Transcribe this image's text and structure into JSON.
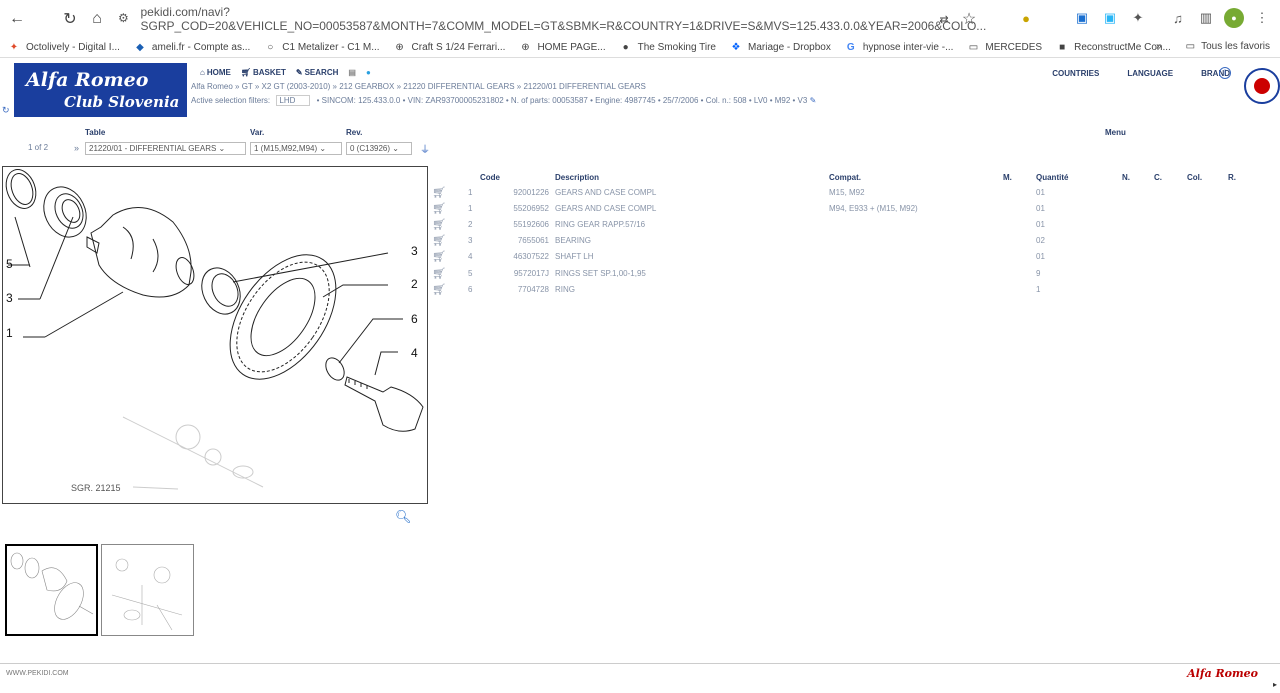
{
  "browser": {
    "url": "pekidi.com/navi?SGRP_COD=20&VEHICLE_NO=00053587&MONTH=7&COMM_MODEL=GT&SBMK=R&COUNTRY=1&DRIVE=S&MVS=125.433.0.0&YEAR=2006&COLO...",
    "bookmarks": [
      {
        "label": "Octolively - Digital I...",
        "icon": "octopus-icon",
        "color": "#e04a2a"
      },
      {
        "label": "ameli.fr - Compte as...",
        "icon": "ameli-icon",
        "color": "#1a5fb4"
      },
      {
        "label": "C1 Metalizer - C1 M...",
        "icon": "globe-icon",
        "color": "#555"
      },
      {
        "label": "Craft S 1/24 Ferrari...",
        "icon": "globe-icon",
        "color": "#555"
      },
      {
        "label": "HOME PAGE...",
        "icon": "globe-icon",
        "color": "#555"
      },
      {
        "label": "The Smoking Tire",
        "icon": "tire-icon",
        "color": "#222"
      },
      {
        "label": "Mariage - Dropbox",
        "icon": "dropbox-icon",
        "color": "#0061fe"
      },
      {
        "label": "hypnose inter-vie -...",
        "icon": "google-icon",
        "color": "#4285f4"
      },
      {
        "label": "MERCEDES",
        "icon": "folder-icon",
        "color": "#555"
      },
      {
        "label": "ReconstructMe Con...",
        "icon": "site-icon",
        "color": "#333"
      }
    ],
    "favorites_label": "Tous les favoris"
  },
  "header": {
    "logo_line1": "Alfa Romeo",
    "logo_line2": "Club Slovenia",
    "nav": [
      {
        "label": "HOME",
        "icon": "home-icon"
      },
      {
        "label": "BASKET",
        "icon": "basket-icon"
      },
      {
        "label": "SEARCH",
        "icon": "search-icon"
      }
    ],
    "right_nav": [
      "COUNTRIES",
      "LANGUAGE",
      "BRAND"
    ],
    "breadcrumb": "Alfa Romeo » GT » X2 GT (2003-2010) » 212 GEARBOX » 21220 DIFFERENTIAL GEARS » 21220/01 DIFFERENTIAL GEARS",
    "filters_label": "Active selection filters:",
    "filters_value": "LHD",
    "filters_rest": "• SINCOM: 125.433.0.0 • VIN: ZAR93700005231802 • N. of parts: 00053587 • Engine: 4987745 • 25/7/2006 • Col. n.: 508 • LV0 • M92 • V3"
  },
  "selectors": {
    "page_info": "1 of 2",
    "table_label": "Table",
    "var_label": "Var.",
    "rev_label": "Rev.",
    "menu_label": "Menu",
    "table_value": "21220/01 - DIFFERENTIAL GEARS",
    "var_value": "1 (M15,M92,M94)",
    "rev_value": "0 (C13926)"
  },
  "drawing": {
    "caption": "SGR. 21215",
    "callouts": [
      "5",
      "3",
      "1",
      "3",
      "2",
      "6",
      "4"
    ]
  },
  "table": {
    "headers": [
      "Code",
      "Description",
      "Compat.",
      "M.",
      "Quantité",
      "N.",
      "C.",
      "Col.",
      "R."
    ],
    "rows": [
      {
        "ref": "1",
        "code": "92001226",
        "desc": "GEARS AND CASE COMPL",
        "compat": "M15, M92",
        "qty": "01"
      },
      {
        "ref": "1",
        "code": "55206952",
        "desc": "GEARS AND CASE COMPL",
        "compat": "M94, E933 + (M15, M92)",
        "qty": "01"
      },
      {
        "ref": "2",
        "code": "55192606",
        "desc": "RING GEAR RAPP.57/16",
        "compat": "",
        "qty": "01"
      },
      {
        "ref": "3",
        "code": "7655061",
        "desc": "BEARING",
        "compat": "",
        "qty": "02"
      },
      {
        "ref": "4",
        "code": "46307522",
        "desc": "SHAFT LH",
        "compat": "",
        "qty": "01"
      },
      {
        "ref": "5",
        "code": "9572017J",
        "desc": "RINGS SET SP.1,00-1,95",
        "compat": "",
        "qty": "9"
      },
      {
        "ref": "6",
        "code": "7704728",
        "desc": "RING",
        "compat": "",
        "qty": "1"
      }
    ]
  },
  "footer": {
    "site": "WWW.PEKIDI.COM",
    "brand": "Alfa Romeo"
  }
}
